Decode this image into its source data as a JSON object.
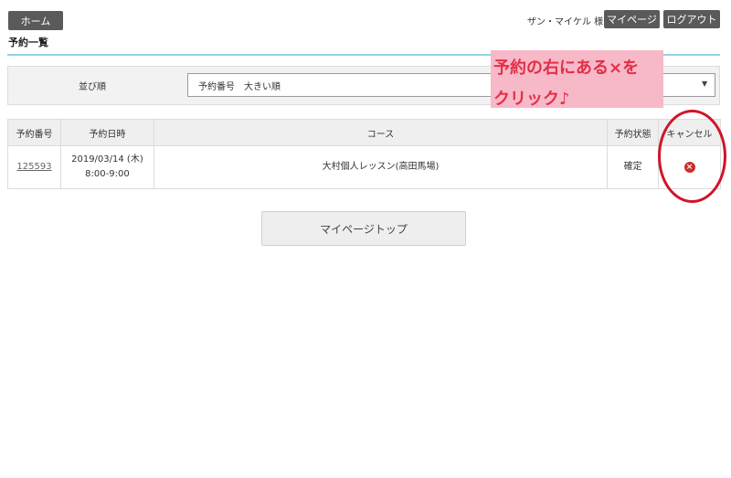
{
  "header": {
    "home_label": "ホーム",
    "user_name": "ザン・マイケル 様",
    "mypage_label": "マイページ",
    "logout_label": "ログアウト",
    "page_title": "予約一覧"
  },
  "sort": {
    "label": "並び順",
    "selected": "予約番号　大きい順"
  },
  "table": {
    "headers": [
      "予約番号",
      "予約日時",
      "コース",
      "予約状態",
      "キャンセル"
    ],
    "rows": [
      {
        "reservation_no": "125593",
        "date": "2019/03/14 (木)",
        "time": "8:00-9:00",
        "course": "大村個人レッスン(高田馬場)",
        "status": "確定"
      }
    ]
  },
  "footer": {
    "mypage_top_label": "マイページトップ"
  },
  "annotation": {
    "line1": "予約の右にある×を",
    "line2": "クリック♪"
  },
  "colors": {
    "accent_rule": "#8fd3e8",
    "annotation_text": "#e03048",
    "annotation_bg": "#f7b8c8",
    "cancel_icon": "#c9302c"
  }
}
